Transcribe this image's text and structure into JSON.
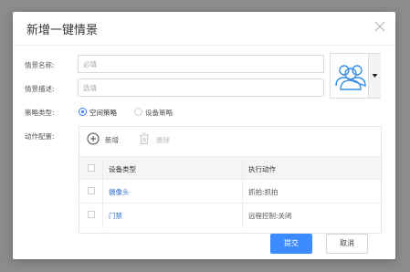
{
  "dialog": {
    "title": "新增一键情景",
    "form": {
      "name_label": "情景名称:",
      "name_placeholder": "必填",
      "desc_label": "情景描述:",
      "desc_placeholder": "选填",
      "strategy_label": "策略类型:",
      "strategy_options": [
        {
          "label": "空间策略",
          "selected": true
        },
        {
          "label": "设备策略",
          "selected": false
        }
      ],
      "action_label": "动作配置:"
    },
    "actions": {
      "add_label": "新增",
      "delete_label": "删除",
      "columns": [
        "设备类型",
        "执行动作"
      ],
      "rows": [
        {
          "device": "摄像头",
          "action": "抓拍:抓拍"
        },
        {
          "device": "门禁",
          "action": "远程控制:关闭"
        }
      ]
    },
    "footer": {
      "submit_label": "提交",
      "cancel_label": "取消"
    },
    "colors": {
      "primary": "#3d8cff",
      "link": "#2f6fd6",
      "avatar": "#3a8ee6"
    },
    "icons": [
      "close-icon",
      "people-group-icon",
      "caret-down-icon",
      "plus-circle-icon",
      "trash-icon"
    ]
  }
}
